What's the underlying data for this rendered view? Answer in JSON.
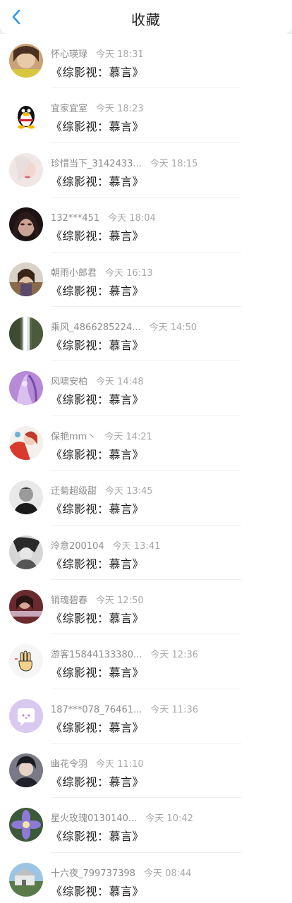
{
  "header": {
    "title": "收藏",
    "back_icon": "chevron-left-icon"
  },
  "colors": {
    "accent": "#2e9bf0",
    "text": "#1a1a1a",
    "meta": "#8c8c8c"
  },
  "items": [
    {
      "name": "怀心瑛琭",
      "time": "今天 18:31",
      "book": "《综影视：慕言》"
    },
    {
      "name": "宜家宜室",
      "time": "今天 18:23",
      "book": "《综影视：慕言》"
    },
    {
      "name": "珍惜当下_3142433...",
      "time": "今天 18:15",
      "book": "《综影视：慕言》"
    },
    {
      "name": "132***451",
      "time": "今天 18:04",
      "book": "《综影视：慕言》"
    },
    {
      "name": "朝雨小郎君",
      "time": "今天 16:13",
      "book": "《综影视：慕言》"
    },
    {
      "name": "乘风_4866285224...",
      "time": "今天 14:50",
      "book": "《综影视：慕言》"
    },
    {
      "name": "风啸安柏",
      "time": "今天 14:48",
      "book": "《综影视：慕言》"
    },
    {
      "name": "保艳mm丶",
      "time": "今天 14:21",
      "book": "《综影视：慕言》"
    },
    {
      "name": "迂菊超级甜",
      "time": "今天 13:45",
      "book": "《综影视：慕言》"
    },
    {
      "name": "泠意200104",
      "time": "今天 13:41",
      "book": "《综影视：慕言》"
    },
    {
      "name": "销魂碧春",
      "time": "今天 12:50",
      "book": "《综影视：慕言》"
    },
    {
      "name": "游客15844133380...",
      "time": "今天 12:36",
      "book": "《综影视：慕言》"
    },
    {
      "name": "187***078_76461...",
      "time": "今天 11:36",
      "book": "《综影视：慕言》"
    },
    {
      "name": "幽花令羽",
      "time": "今天 11:10",
      "book": "《综影视：慕言》"
    },
    {
      "name": "星火玫瑰0130140...",
      "time": "今天 10:42",
      "book": "《综影视：慕言》"
    },
    {
      "name": "十六夜_799737398",
      "time": "今天 08:44",
      "book": "《综影视：慕言》"
    }
  ]
}
